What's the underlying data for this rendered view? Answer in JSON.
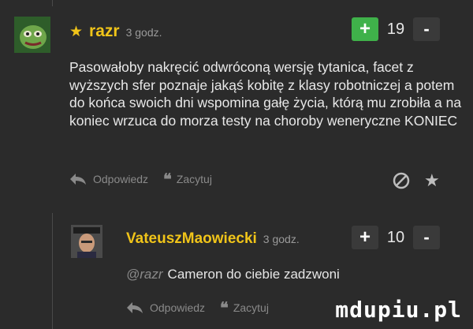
{
  "comments": [
    {
      "username": "razr",
      "time": "3 godz.",
      "score": "19",
      "plus": "+",
      "minus": "-",
      "text": "Pasowałoby nakręcić odwróconą wersję tytanica, facet z wyższych sfer poznaje jakąś kobitę z klasy robotniczej a potem do końca swoich dni wspomina gałę życia, którą mu zrobiła a na koniec wrzuca do morza testy na choroby weneryczne KONIEC",
      "reply_label": "Odpowiedz",
      "quote_label": "Zacytuj"
    },
    {
      "username": "VateuszMaowiecki",
      "time": "3 godz.",
      "score": "10",
      "plus": "+",
      "minus": "-",
      "mention": "@razr",
      "text": "Cameron do ciebie zadzwoni",
      "reply_label": "Odpowiedz",
      "quote_label": "Zacytuj"
    }
  ],
  "watermark": "mdupiu.pl",
  "colors": {
    "accent": "#f0c419",
    "plus_active": "#3fb14a",
    "background": "#2b2b2b"
  }
}
